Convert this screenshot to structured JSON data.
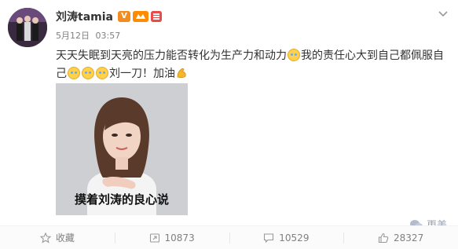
{
  "user": {
    "name": "刘涛tamia",
    "vip_mark": "V"
  },
  "post": {
    "date": "5月12日",
    "time": "03:57",
    "text_part1": "天天失眠到天亮的压力能否转化为生产力和动力",
    "text_part2": "我的责任心大到自己都佩服自",
    "text_part3": "己",
    "text_part4": "刘一刀！加油",
    "image_caption": "摸着刘涛的良心说"
  },
  "actions": {
    "favorite_label": "收藏",
    "repost_count": "10873",
    "comment_count": "10529",
    "like_count": "28327"
  },
  "watermark": {
    "text": "更美"
  },
  "icons": [
    "vip-icon",
    "badge-icon",
    "chevron-down-icon",
    "laugh-cry-emoji-icon",
    "muscle-icon",
    "star-icon",
    "repost-icon",
    "comment-icon",
    "thumbs-up-icon",
    "wechat-icon"
  ]
}
